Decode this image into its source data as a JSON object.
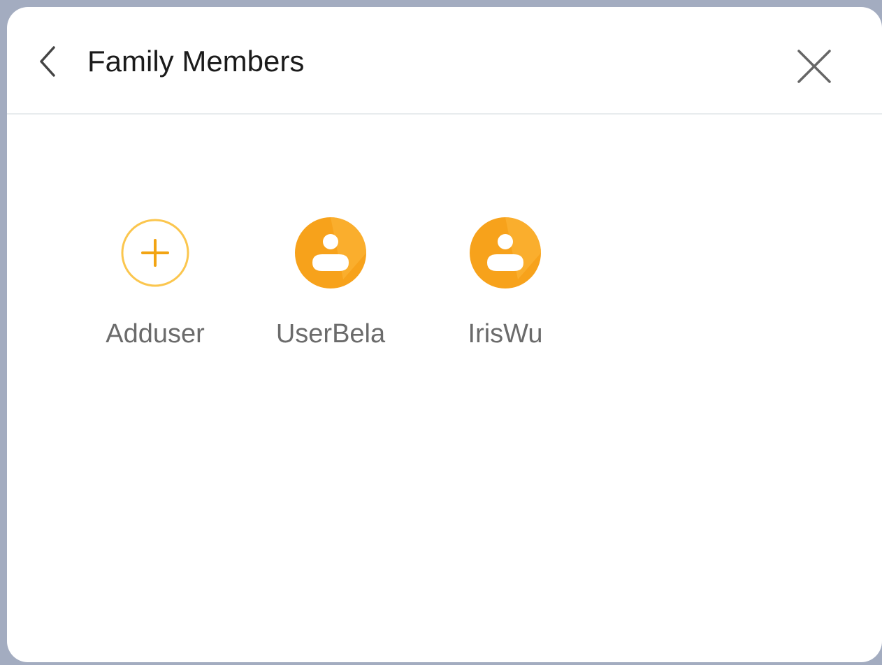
{
  "header": {
    "title": "Family Members",
    "back_icon": "chevron-left-icon",
    "close_icon": "close-icon"
  },
  "members": [
    {
      "label": "Adduser",
      "icon": "add-circle-icon"
    },
    {
      "label": "UserBela",
      "icon": "user-avatar-icon"
    },
    {
      "label": "IrisWu",
      "icon": "user-avatar-icon"
    }
  ],
  "colors": {
    "accent": "#f7a21b",
    "accent_light": "#fdc55a",
    "background": "#a3acc0",
    "panel": "#ffffff",
    "divider": "#e8ecee",
    "title_text": "#1b1b1b",
    "label_text": "#6b6b6b"
  }
}
